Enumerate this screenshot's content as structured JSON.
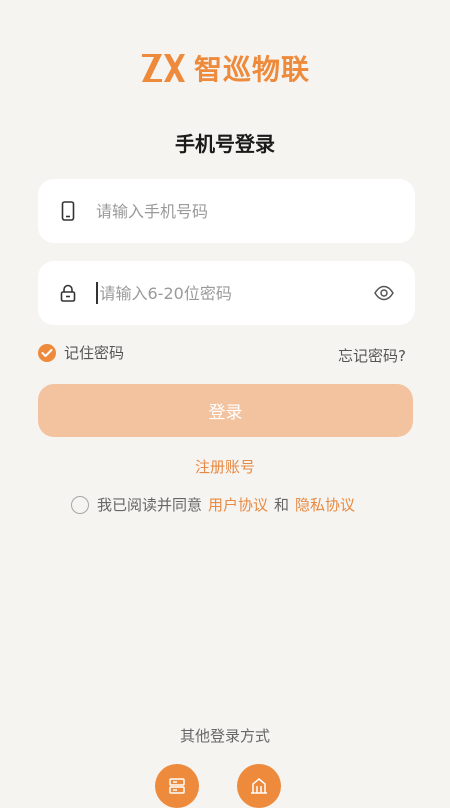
{
  "colors": {
    "accent": "#ee8a3c",
    "button_bg": "#f3c29f",
    "link": "#e78a43"
  },
  "brand": {
    "logo_mark": "ZX",
    "name": "智巡物联"
  },
  "page": {
    "title": "手机号登录"
  },
  "form": {
    "phone": {
      "icon": "phone-icon",
      "placeholder": "请输入手机号码",
      "value": ""
    },
    "password": {
      "icon": "lock-icon",
      "placeholder": "请输入6-20位密码",
      "value": "",
      "toggle_icon": "eye-icon"
    },
    "remember": {
      "label": "记住密码",
      "checked": true
    },
    "forgot_label": "忘记密码?",
    "login_label": "登录",
    "register_label": "注册账号"
  },
  "agreement": {
    "checked": false,
    "prefix": "我已阅读并同意",
    "user_agreement": "用户协议",
    "conjunction": "和",
    "privacy_policy": "隐私协议"
  },
  "other_login": {
    "label": "其他登录方式",
    "methods": [
      {
        "icon": "server-icon"
      },
      {
        "icon": "building-icon"
      }
    ]
  }
}
